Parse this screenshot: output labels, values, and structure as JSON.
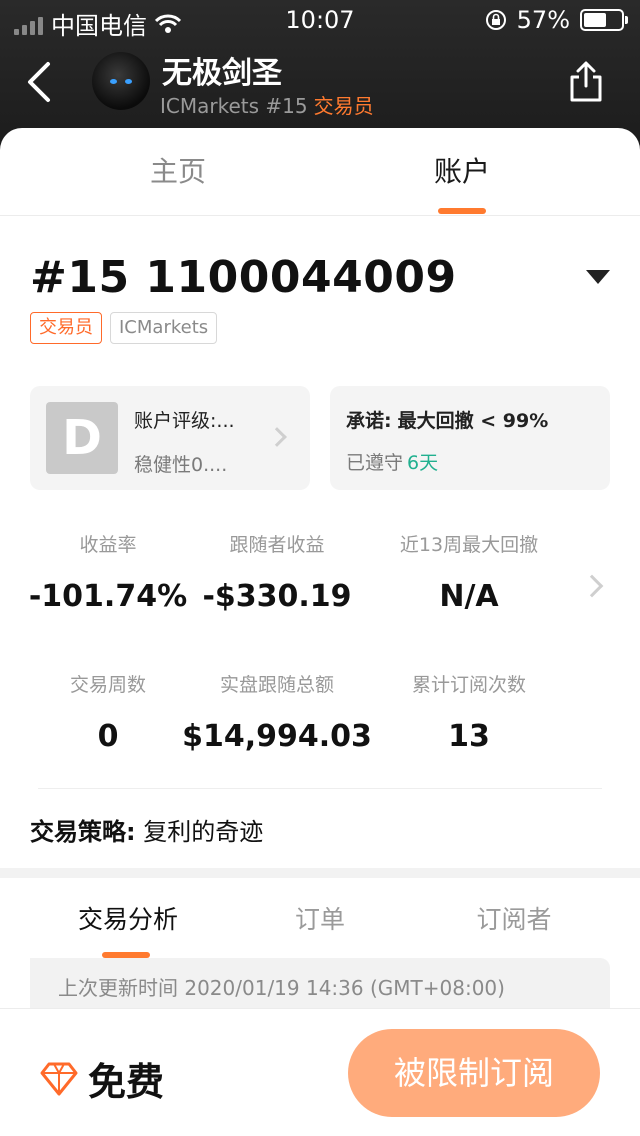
{
  "status_bar": {
    "carrier": "中国电信",
    "time": "10:07",
    "battery": "57%"
  },
  "nav": {
    "name": "无极剑圣",
    "broker_rank": "ICMarkets #15",
    "role": "交易员"
  },
  "tabs": {
    "home": "主页",
    "account": "账户"
  },
  "account": {
    "title": "#15 1100044009",
    "tag_role": "交易员",
    "tag_broker": "ICMarkets"
  },
  "rating_card": {
    "grade": "D",
    "title": "账户评级:...",
    "subtitle": "稳健性0...."
  },
  "promise_card": {
    "label": "承诺:",
    "text": "最大回撤 < 99%",
    "kept_label": "已遵守",
    "days": "6天"
  },
  "stats": [
    {
      "label": "收益率",
      "value": "-101.74%"
    },
    {
      "label": "跟随者收益",
      "value": "-$330.19"
    },
    {
      "label": "近13周最大回撤",
      "value": "N/A"
    },
    {
      "label": "交易周数",
      "value": "0"
    },
    {
      "label": "实盘跟随总额",
      "value": "$14,994.03"
    },
    {
      "label": "累计订阅次数",
      "value": "13"
    }
  ],
  "strategy": {
    "label": "交易策略:",
    "value": "复利的奇迹"
  },
  "sub_tabs": [
    "交易分析",
    "订单",
    "订阅者"
  ],
  "update": "上次更新时间 2020/01/19 14:36 (GMT+08:00)",
  "footer": {
    "price": "免费",
    "subscribe": "被限制订阅"
  },
  "colors": {
    "accent": "#ff7a2f",
    "green": "#21b08f",
    "subscribe_bg": "#ffab7c"
  }
}
